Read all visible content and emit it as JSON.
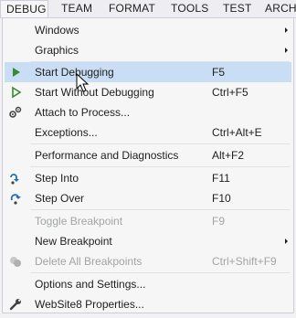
{
  "menubar": {
    "items": [
      {
        "label": "DEBUG"
      },
      {
        "label": "TEAM"
      },
      {
        "label": "FORMAT"
      },
      {
        "label": "TOOLS"
      },
      {
        "label": "TEST"
      },
      {
        "label": "ARCHI"
      }
    ]
  },
  "menu": {
    "items": [
      {
        "label": "Windows",
        "shortcut": "",
        "has_submenu": true,
        "enabled": true,
        "icon": ""
      },
      {
        "label": "Graphics",
        "shortcut": "",
        "has_submenu": true,
        "enabled": true,
        "icon": ""
      },
      {
        "label": "Start Debugging",
        "shortcut": "F5",
        "has_submenu": false,
        "enabled": true,
        "icon": "start-debugging-icon",
        "highlighted": true
      },
      {
        "label": "Start Without Debugging",
        "shortcut": "Ctrl+F5",
        "has_submenu": false,
        "enabled": true,
        "icon": "start-without-debugging-icon"
      },
      {
        "label": "Attach to Process...",
        "shortcut": "",
        "has_submenu": false,
        "enabled": true,
        "icon": "attach-to-process-icon"
      },
      {
        "label": "Exceptions...",
        "shortcut": "Ctrl+Alt+E",
        "has_submenu": false,
        "enabled": true,
        "icon": ""
      },
      {
        "label": "Performance and Diagnostics",
        "shortcut": "Alt+F2",
        "has_submenu": false,
        "enabled": true,
        "icon": ""
      },
      {
        "label": "Step Into",
        "shortcut": "F11",
        "has_submenu": false,
        "enabled": true,
        "icon": "step-into-icon"
      },
      {
        "label": "Step Over",
        "shortcut": "F10",
        "has_submenu": false,
        "enabled": true,
        "icon": "step-over-icon"
      },
      {
        "label": "Toggle Breakpoint",
        "shortcut": "F9",
        "has_submenu": false,
        "enabled": false,
        "icon": ""
      },
      {
        "label": "New Breakpoint",
        "shortcut": "",
        "has_submenu": true,
        "enabled": true,
        "icon": ""
      },
      {
        "label": "Delete All Breakpoints",
        "shortcut": "Ctrl+Shift+F9",
        "has_submenu": false,
        "enabled": false,
        "icon": "delete-all-breakpoints-icon"
      },
      {
        "label": "Options and Settings...",
        "shortcut": "",
        "has_submenu": false,
        "enabled": true,
        "icon": ""
      },
      {
        "label": "WebSite8 Properties...",
        "shortcut": "",
        "has_submenu": false,
        "enabled": true,
        "icon": "wrench-icon"
      }
    ]
  },
  "colors": {
    "highlight": "#c9def5",
    "play_green": "#388a34",
    "step_blue": "#1e6fb8",
    "disabled_text": "#a2a4a5"
  }
}
